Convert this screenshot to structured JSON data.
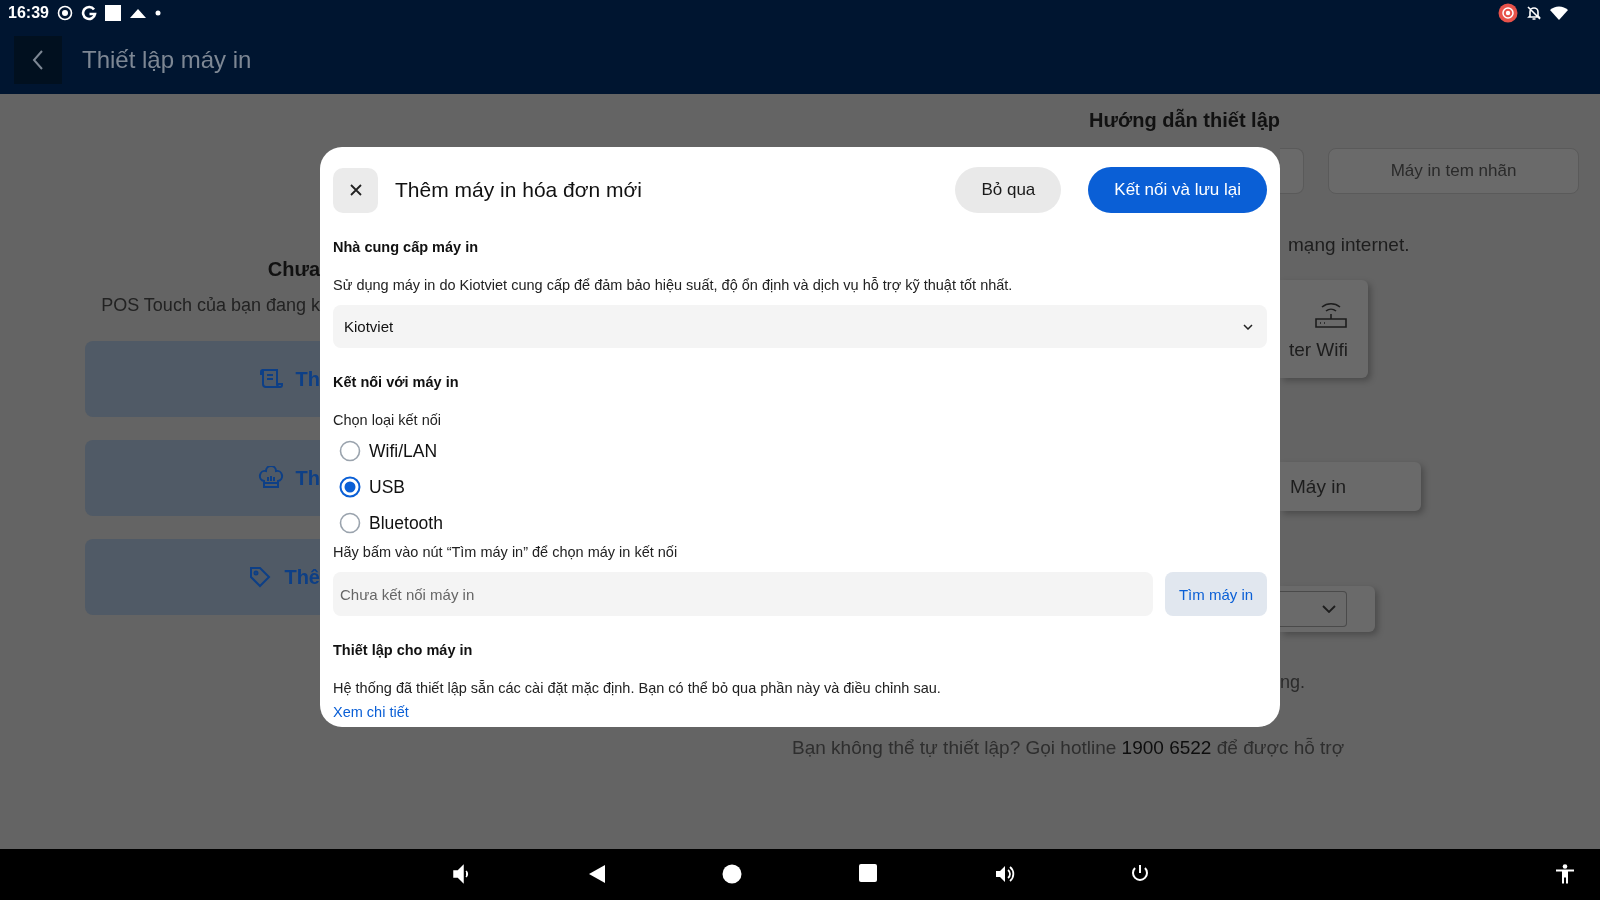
{
  "status_bar": {
    "time": "16:39"
  },
  "header": {
    "title": "Thiết lập máy in"
  },
  "left_panel": {
    "title": "Chưa",
    "subtitle": "POS Touch của bạn đang k",
    "cards": [
      {
        "label": "Th",
        "kind": "receipt"
      },
      {
        "label": "Th",
        "kind": "chef"
      },
      {
        "label": "Thê",
        "kind": "tag"
      }
    ]
  },
  "right_panel": {
    "title": "Hướng dẫn thiết lập",
    "tabs": [
      "Máy in tem nhãn"
    ],
    "text": "mạng internet.",
    "options": [
      {
        "label": "ter Wifi",
        "kind": "router"
      }
    ],
    "printer_button": "Máy in",
    "note": "ng."
  },
  "footer": {
    "before": "Bạn không thể tự thiết lập? Gọi hotline",
    "hotline": "1900 6522",
    "after": "để được hỗ trợ"
  },
  "dialog": {
    "title": "Thêm máy in hóa đơn mới",
    "buttons": [
      {
        "label": "Bỏ qua",
        "kind": "secondary"
      },
      {
        "label": "Kết nối và lưu lại",
        "kind": "primary"
      }
    ],
    "provider": {
      "heading": "Nhà cung cấp máy in",
      "description": "Sử dụng máy in do Kiotviet cung cấp để đảm bảo hiệu suất, độ ổn định và dịch vụ hỗ trợ kỹ thuật tốt nhất.",
      "value": "Kiotviet"
    },
    "connection": {
      "heading": "Kết nối với máy in",
      "label": "Chọn loại kết nối",
      "options": [
        {
          "label": "Wifi/LAN",
          "selected": false
        },
        {
          "label": "USB",
          "selected": true
        },
        {
          "label": "Bluetooth",
          "selected": false
        }
      ],
      "hint": "Hãy bấm vào nút “Tìm máy in” để chọn máy in kết nối",
      "placeholder": "Chưa kết nối máy in",
      "search_button": "Tìm máy in"
    },
    "settings": {
      "heading": "Thiết lập cho máy in",
      "description": "Hệ thống đã thiết lập sẵn các cài đặt mặc định. Bạn có thể bỏ qua phần này và điều chỉnh sau.",
      "link": "Xem chi tiết"
    }
  }
}
